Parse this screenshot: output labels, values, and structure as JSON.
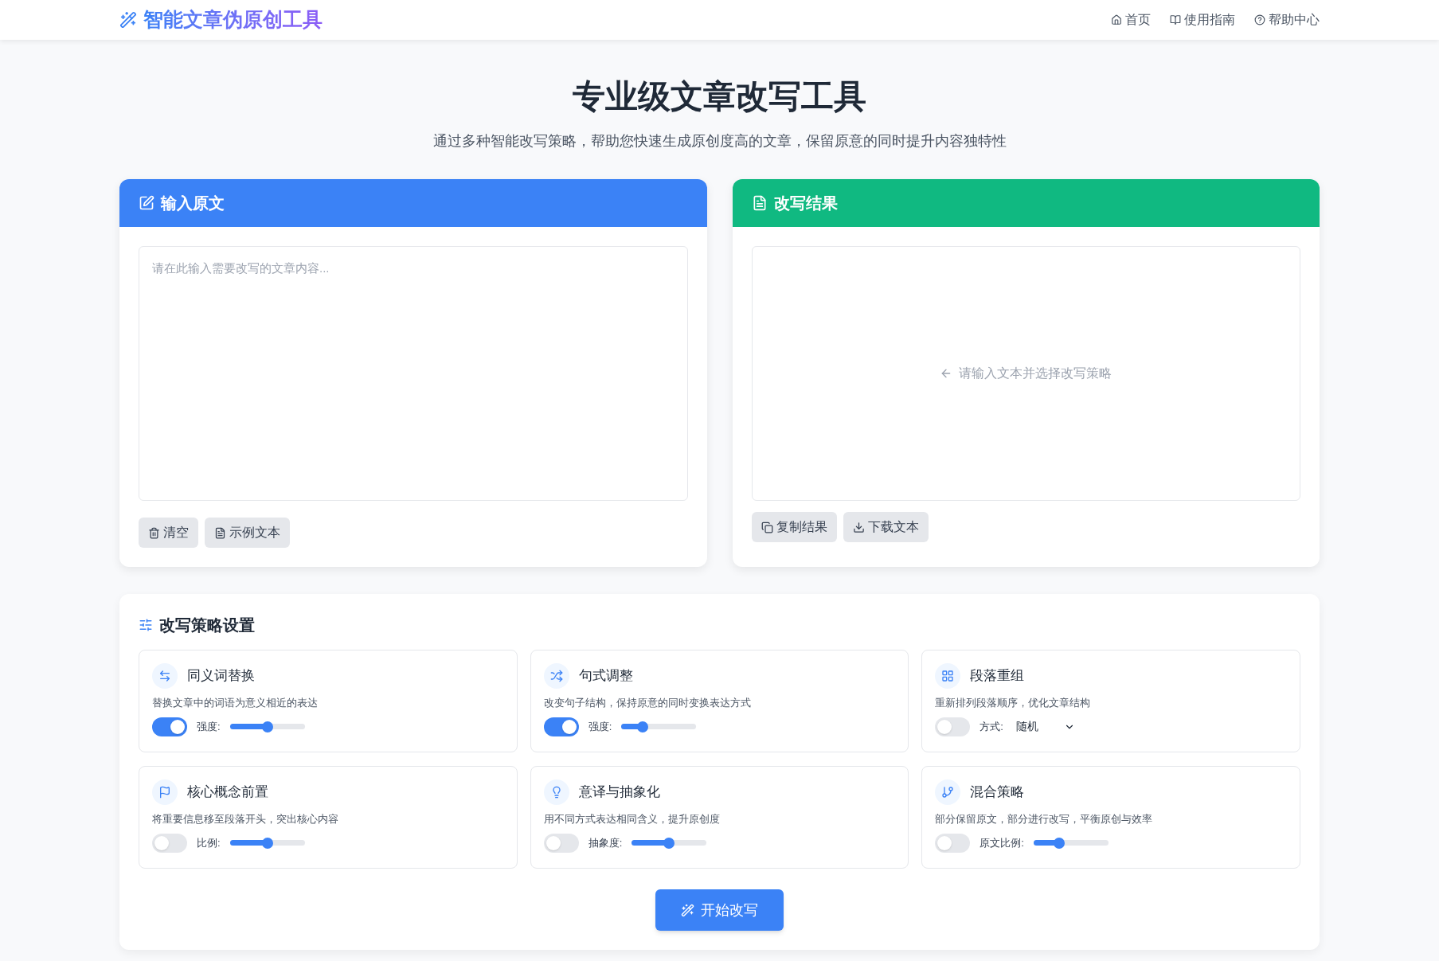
{
  "brand": "智能文章伪原创工具",
  "nav": [
    {
      "label": "首页"
    },
    {
      "label": "使用指南"
    },
    {
      "label": "帮助中心"
    }
  ],
  "hero": {
    "title": "专业级文章改写工具",
    "subtitle": "通过多种智能改写策略，帮助您快速生成原创度高的文章，保留原意的同时提升内容独特性"
  },
  "input_panel": {
    "title": "输入原文",
    "placeholder": "请在此输入需要改写的文章内容...",
    "buttons": [
      "清空",
      "示例文本"
    ]
  },
  "result_panel": {
    "title": "改写结果",
    "empty_hint": "请输入文本并选择改写策略",
    "buttons": [
      "复制结果",
      "下载文本"
    ]
  },
  "settings": {
    "title": "改写策略设置",
    "strategies": [
      {
        "name": "同义词替换",
        "description": "替换文章中的词语为意义相近的表达",
        "on": true,
        "kind": "slider",
        "control_label": "强度:",
        "level": 0.5
      },
      {
        "name": "句式调整",
        "description": "改变句子结构，保持原意的同时变换表达方式",
        "on": true,
        "kind": "slider",
        "control_label": "强度:",
        "level": 0.28
      },
      {
        "name": "段落重组",
        "description": "重新排列段落顺序，优化文章结构",
        "on": false,
        "kind": "select",
        "control_label": "方式:",
        "value": "随机"
      },
      {
        "name": "核心概念前置",
        "description": "将重要信息移至段落开头，突出核心内容",
        "on": false,
        "kind": "slider",
        "control_label": "比例:",
        "level": 0.5
      },
      {
        "name": "意译与抽象化",
        "description": "用不同方式表达相同含义，提升原创度",
        "on": false,
        "kind": "slider",
        "control_label": "抽象度:",
        "level": 0.5
      },
      {
        "name": "混合策略",
        "description": "部分保留原文，部分进行改写，平衡原创与效率",
        "on": false,
        "kind": "slider",
        "control_label": "原文比例:",
        "level": 0.34
      }
    ],
    "start_button": "开始改写"
  }
}
